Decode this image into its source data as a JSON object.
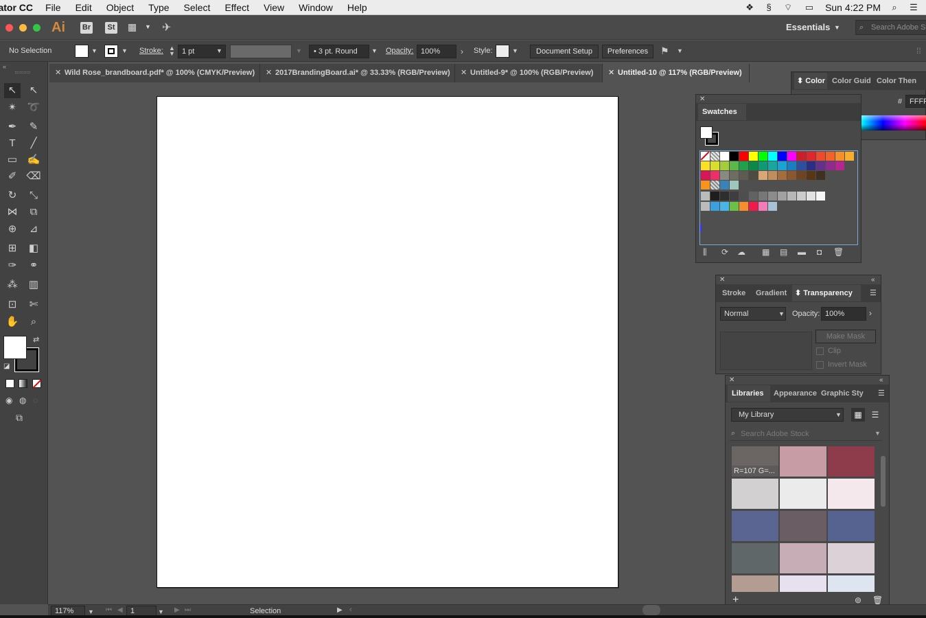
{
  "menubar": {
    "app": "rator CC",
    "items": [
      "File",
      "Edit",
      "Object",
      "Type",
      "Select",
      "Effect",
      "View",
      "Window",
      "Help"
    ],
    "clock": "Sun 4:22 PM"
  },
  "appbar": {
    "logo": "Ai",
    "bridge": "Br",
    "stock": "St",
    "workspace": "Essentials",
    "search_placeholder": "Search Adobe St"
  },
  "control": {
    "selection": "No Selection",
    "stroke_label": "Stroke:",
    "stroke_value": "1 pt",
    "brush": "3 pt. Round",
    "opacity_label": "Opacity:",
    "opacity_value": "100%",
    "style_label": "Style:",
    "doc_setup": "Document Setup",
    "preferences": "Preferences"
  },
  "tabs": [
    {
      "label": "Wild Rose_brandboard.pdf* @ 100% (CMYK/Preview)"
    },
    {
      "label": "2017BrandingBoard.ai* @ 33.33% (RGB/Preview)"
    },
    {
      "label": "Untitled-9* @ 100% (RGB/Preview)"
    },
    {
      "label": "Untitled-10 @ 117% (RGB/Preview)"
    }
  ],
  "status": {
    "zoom": "117%",
    "page": "1",
    "tool": "Selection"
  },
  "color_panel": {
    "tabs": [
      "Color",
      "Color Guid",
      "Color Then"
    ],
    "hex_label": "#",
    "hex_value": "FFFFF"
  },
  "swatches_panel": {
    "title": "Swatches"
  },
  "transparency_panel": {
    "tabs": [
      "Stroke",
      "Gradient",
      "Transparency"
    ],
    "blend_mode": "Normal",
    "opacity_label": "Opacity:",
    "opacity_value": "100%",
    "make_mask": "Make Mask",
    "clip": "Clip",
    "invert_mask": "Invert Mask"
  },
  "libraries_panel": {
    "tabs": [
      "Libraries",
      "Appearance",
      "Graphic Styl"
    ],
    "library": "My Library",
    "search_placeholder": "Search Adobe Stock",
    "first_swatch_label": "R=107 G=...",
    "swatch_colors": [
      "#6b6564",
      "#c79ca4",
      "#8e3c4c",
      "#d2d0d1",
      "#ebebeb",
      "#f5e8ec",
      "#5a6591",
      "#6a5d64",
      "#56628f",
      "#606768",
      "#c7adb6",
      "#dcd1d7",
      "#b39c92",
      "#e6e0ef",
      "#dfe5f0"
    ]
  },
  "colors": {
    "swatch_row1": [
      "#ffffff",
      "#000000",
      "#ff0000",
      "#ffff00",
      "#00ff00",
      "#00ffff",
      "#0000ff",
      "#ff00ff",
      "#cc1f2d",
      "#e1262d",
      "#ee4a2c",
      "#f0642b",
      "#f58f2b",
      "#f8ae2d"
    ],
    "swatch_row2": [
      "#f9e225",
      "#d8de2a",
      "#a4cc3b",
      "#5ab748",
      "#1ea24a",
      "#0a8a49",
      "#0f9a75",
      "#18a7a0",
      "#1aa3d5",
      "#1a7ec1",
      "#2d4fa1",
      "#2b2e86",
      "#63308d",
      "#8f2b8f",
      "#b62591"
    ],
    "swatch_row3": [
      "#d7155a",
      "#ee2f6a",
      "#8a8a82",
      "#6f6c62",
      "#5e5b52",
      "#4e4b42",
      "#d9a675",
      "#c18d5c",
      "#a66d3c",
      "#8a572f",
      "#6e4423",
      "#593618",
      "#403022"
    ],
    "swatch_gray": [
      "#1e1e1e",
      "#2e2e2e",
      "#3e3e3e",
      "#4e4e4e",
      "#626262",
      "#777777",
      "#8c8c8c",
      "#a1a1a1",
      "#b7b7b7",
      "#cccccc",
      "#e2e2e2",
      "#f6f6f6"
    ],
    "swatch_brand": [
      "#3aa0e0",
      "#4ab5e8",
      "#6bc045",
      "#f68d2e",
      "#ef1c4b",
      "#f37bb7",
      "#a6c1d8"
    ]
  }
}
